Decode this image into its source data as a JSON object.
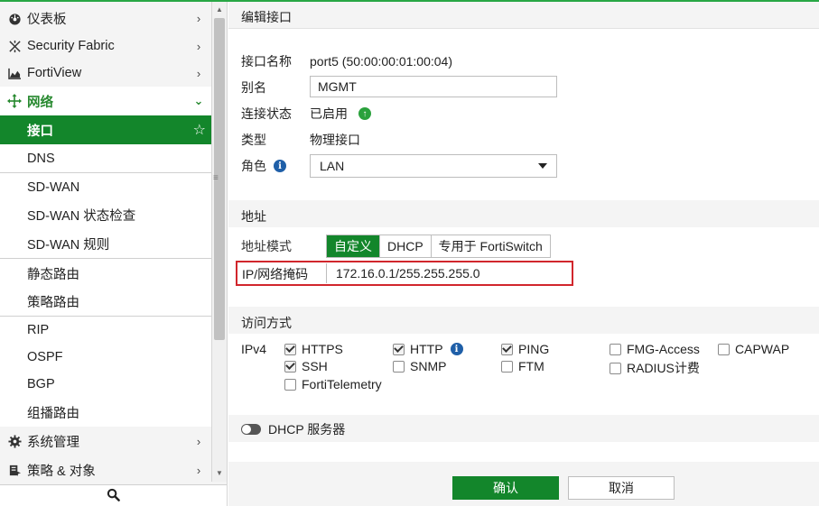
{
  "sidebar": {
    "items": [
      {
        "label": "仪表板",
        "icon": "dashboard-icon"
      },
      {
        "label": "Security Fabric",
        "icon": "security-fabric-icon"
      },
      {
        "label": "FortiView",
        "icon": "fortiview-chart-icon"
      },
      {
        "label": "网络",
        "icon": "network-move-icon"
      },
      {
        "label": "系统管理",
        "icon": "gear-icon"
      },
      {
        "label": "策略 & 对象",
        "icon": "policy-icon"
      }
    ],
    "network_sub": [
      {
        "label": "接口"
      },
      {
        "label": "DNS"
      },
      {
        "label": "SD-WAN"
      },
      {
        "label": "SD-WAN 状态检查"
      },
      {
        "label": "SD-WAN 规则"
      },
      {
        "label": "静态路由"
      },
      {
        "label": "策略路由"
      },
      {
        "label": "RIP"
      },
      {
        "label": "OSPF"
      },
      {
        "label": "BGP"
      },
      {
        "label": "组播路由"
      }
    ]
  },
  "page": {
    "title": "编辑接口",
    "interface_name_label": "接口名称",
    "interface_name_value": "port5 (50:00:00:01:00:04)",
    "alias_label": "别名",
    "alias_value": "MGMT",
    "link_status_label": "连接状态",
    "link_status_value": "已启用",
    "type_label": "类型",
    "type_value": "物理接口",
    "role_label": "角色",
    "role_value": "LAN"
  },
  "address": {
    "section_title": "地址",
    "mode_label": "地址模式",
    "modes": [
      "自定义",
      "DHCP",
      "专用于 FortiSwitch"
    ],
    "ip_mask_label": "IP/网络掩码",
    "ip_mask_value": "172.16.0.1/255.255.255.0"
  },
  "access": {
    "section_title": "访问方式",
    "ipv4_label": "IPv4",
    "options": [
      {
        "label": "HTTPS",
        "checked": true
      },
      {
        "label": "HTTP",
        "checked": true
      },
      {
        "label": "PING",
        "checked": true
      },
      {
        "label": "FMG-Access",
        "checked": false
      },
      {
        "label": "CAPWAP",
        "checked": false
      },
      {
        "label": "SSH",
        "checked": true
      },
      {
        "label": "SNMP",
        "checked": false
      },
      {
        "label": "FTM",
        "checked": false
      },
      {
        "label": "RADIUS计费",
        "checked": false
      },
      {
        "label": "FortiTelemetry",
        "checked": false
      }
    ]
  },
  "dhcp": {
    "label": "DHCP 服务器",
    "enabled": false
  },
  "footer": {
    "ok_label": "确认",
    "cancel_label": "取消"
  },
  "colors": {
    "accent": "#13862b",
    "highlight_border": "#d1262c"
  }
}
